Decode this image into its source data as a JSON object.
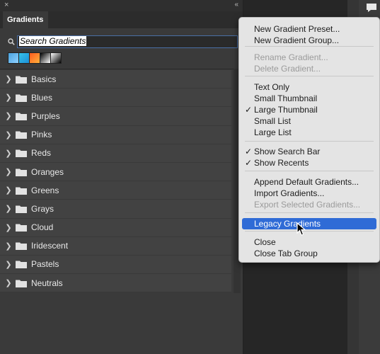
{
  "panel": {
    "close_glyph": "×",
    "collapse_glyph": "«",
    "tab_title": "Gradients",
    "search": {
      "value": "Search Gradients"
    },
    "recent_swatches": [
      {
        "name": "blue",
        "colors": [
          "#4aa3df",
          "#8fd0ff"
        ]
      },
      {
        "name": "cyan",
        "colors": [
          "#35c2e9",
          "#1e90d6"
        ]
      },
      {
        "name": "orange",
        "colors": [
          "#ff5a1f",
          "#ffb13b"
        ]
      },
      {
        "name": "black-white",
        "colors": [
          "#000000",
          "#ffffff"
        ]
      },
      {
        "name": "white-black",
        "colors": [
          "#ffffff",
          "#000000"
        ]
      }
    ],
    "groups": [
      "Basics",
      "Blues",
      "Purples",
      "Pinks",
      "Reds",
      "Oranges",
      "Greens",
      "Grays",
      "Cloud",
      "Iridescent",
      "Pastels",
      "Neutrals"
    ]
  },
  "menu": {
    "items": [
      {
        "label": "New Gradient Preset...",
        "enabled": true,
        "checked": false
      },
      {
        "label": "New Gradient Group...",
        "enabled": true,
        "checked": false
      },
      {
        "label": "Rename Gradient...",
        "enabled": false,
        "checked": false
      },
      {
        "label": "Delete Gradient...",
        "enabled": false,
        "checked": false
      },
      {
        "label": "Text Only",
        "enabled": true,
        "checked": false
      },
      {
        "label": "Small Thumbnail",
        "enabled": true,
        "checked": false
      },
      {
        "label": "Large Thumbnail",
        "enabled": true,
        "checked": true
      },
      {
        "label": "Small List",
        "enabled": true,
        "checked": false
      },
      {
        "label": "Large List",
        "enabled": true,
        "checked": false
      },
      {
        "label": "Show Search Bar",
        "enabled": true,
        "checked": true
      },
      {
        "label": "Show Recents",
        "enabled": true,
        "checked": true
      },
      {
        "label": "Append Default Gradients...",
        "enabled": true,
        "checked": false
      },
      {
        "label": "Import Gradients...",
        "enabled": true,
        "checked": false
      },
      {
        "label": "Export Selected Gradients...",
        "enabled": false,
        "checked": false
      },
      {
        "label": "Legacy Gradients",
        "enabled": true,
        "checked": false,
        "highlighted": true
      },
      {
        "label": "Close",
        "enabled": true,
        "checked": false
      },
      {
        "label": "Close Tab Group",
        "enabled": true,
        "checked": false
      }
    ],
    "check_glyph": "✓"
  },
  "colors": {
    "highlight": "#2f6bd6",
    "menu_bg": "#e4e4e4",
    "panel_bg": "#3a3a3a"
  }
}
